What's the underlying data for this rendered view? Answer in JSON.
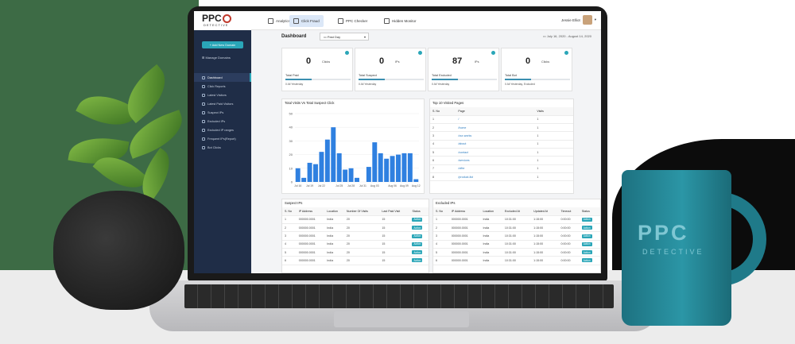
{
  "app": {
    "logo": "PPC",
    "logo_sub": "DETECTIVE"
  },
  "topbar": {
    "tabs": [
      {
        "label": "Analytics",
        "active": false
      },
      {
        "label": "Click Fraud",
        "active": true
      },
      {
        "label": "PPC Checker",
        "active": false
      },
      {
        "label": "Hidden Monitor",
        "active": false
      }
    ],
    "user_name": "Jessie Elliot"
  },
  "sidebar": {
    "add_button": "+ Add New Domain",
    "manage": "Manage Domains",
    "items": [
      {
        "label": "Dashboard",
        "active": true
      },
      {
        "label": "Click Reports",
        "active": false
      },
      {
        "label": "Latest Visitors",
        "active": false
      },
      {
        "label": "Latest Paid Visitors",
        "active": false
      },
      {
        "label": "Suspect IPs",
        "active": false
      },
      {
        "label": "Excluded IPs",
        "active": false
      },
      {
        "label": "Excluded IP ranges",
        "active": false
      },
      {
        "label": "Frequent IPs(Report)",
        "active": false
      },
      {
        "label": "Bot Clicks",
        "active": false
      }
    ]
  },
  "header": {
    "title": "Dashboard",
    "period": "Past Day",
    "date_range": "July 16, 2020 - August 14, 2020"
  },
  "stats": [
    {
      "value": "0",
      "unit": "Clicks",
      "label": "Total Paid",
      "fill": 0.4,
      "sub": "0 All Yesterday"
    },
    {
      "value": "0",
      "unit": "IPs",
      "label": "Total Suspect",
      "fill": 0.4,
      "sub": "0 All Yesterday"
    },
    {
      "value": "87",
      "unit": "IPs",
      "label": "Total Excluded",
      "fill": 0.4,
      "sub": "0 All Yesterday"
    },
    {
      "value": "0",
      "unit": "Clicks",
      "label": "Total Bot",
      "fill": 0.4,
      "sub": "0 All Yesterday, Excluded"
    }
  ],
  "chart_data": {
    "type": "bar",
    "title": "Total Visits Vs Total Suspect Click",
    "ylim": [
      0,
      50
    ],
    "yticks": [
      0,
      10,
      20,
      30,
      40,
      50
    ],
    "values": [
      10,
      3,
      14,
      13,
      22,
      31,
      40,
      21,
      9,
      10,
      3,
      0,
      11,
      29,
      21,
      17,
      19,
      20,
      21,
      21,
      2
    ],
    "tick_labels": [
      "Jul 16",
      "Jul 19",
      "Jul 22",
      "Jul 25",
      "Jul 28",
      "Jul 31",
      "Aug 03",
      "Aug 06",
      "Aug 09",
      "Aug 12"
    ],
    "bar_color": "#2f80e0"
  },
  "top_pages": {
    "title": "Top 10 Visited Pages",
    "headers": [
      "S. No",
      "Page",
      "Visits"
    ],
    "rows": [
      [
        "1",
        "/",
        "1"
      ],
      [
        "2",
        "/home",
        "1"
      ],
      [
        "3",
        "/our-works",
        "1"
      ],
      [
        "4",
        "/about",
        "1"
      ],
      [
        "5",
        "/contact",
        "1"
      ],
      [
        "6",
        "/services",
        "1"
      ],
      [
        "7",
        "/offer",
        "1"
      ],
      [
        "8",
        "/product-list",
        "1"
      ]
    ]
  },
  "suspect_ips": {
    "title": "Suspect IPs",
    "headers": [
      "S. No",
      "IP Address",
      "Location",
      "Number Of Visits",
      "Last Paid Visit",
      "Status"
    ],
    "rows": [
      [
        "1",
        "000000.0001",
        "India",
        "20",
        "15",
        "Action"
      ],
      [
        "2",
        "000000.0001",
        "India",
        "20",
        "15",
        "Action"
      ],
      [
        "3",
        "000000.0001",
        "India",
        "20",
        "15",
        "Action"
      ],
      [
        "4",
        "000000.0001",
        "India",
        "20",
        "15",
        "Action"
      ],
      [
        "5",
        "000000.0001",
        "India",
        "20",
        "15",
        "Action"
      ],
      [
        "6",
        "000000.0001",
        "India",
        "20",
        "15",
        "Action"
      ]
    ]
  },
  "excluded_ips": {
    "title": "Excluded IPs",
    "headers": [
      "S. No",
      "IP Address",
      "Location",
      "Excluded At",
      "Updated At",
      "Timeout",
      "Status"
    ],
    "rows": [
      [
        "1",
        "000000.0001",
        "India",
        "10:31:00",
        "1:15:00",
        "0:00:00",
        "Action"
      ],
      [
        "2",
        "000000.0001",
        "India",
        "10:31:00",
        "1:15:00",
        "0:00:00",
        "Action"
      ],
      [
        "3",
        "000000.0001",
        "India",
        "10:31:00",
        "1:15:00",
        "0:00:00",
        "Action"
      ],
      [
        "4",
        "000000.0001",
        "India",
        "10:31:00",
        "1:15:00",
        "0:00:00",
        "Action"
      ],
      [
        "5",
        "000000.0001",
        "India",
        "10:31:00",
        "1:15:00",
        "0:00:00",
        "Action"
      ],
      [
        "6",
        "000000.0001",
        "India",
        "10:31:00",
        "1:15:00",
        "0:00:00",
        "Action"
      ]
    ]
  },
  "mug": {
    "logo": "PPC",
    "sub": "DETECTIVE"
  }
}
